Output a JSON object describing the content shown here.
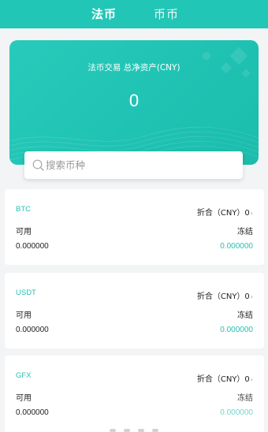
{
  "tabs": [
    {
      "label": "法币",
      "active": true
    },
    {
      "label": "币币",
      "active": false
    }
  ],
  "colors": {
    "accent": "#22c6b6",
    "coin_name": "#27bfb2",
    "background": "#f2f4f5"
  },
  "asset_card": {
    "title": "法币交易 总净资产(CNY)",
    "value": "0"
  },
  "search": {
    "placeholder": "搜索币种",
    "value": "",
    "icon": "search-icon"
  },
  "coins": [
    {
      "name": "BTC",
      "conversion": "折合（CNY）0",
      "available_label": "可用",
      "frozen_label": "冻结",
      "available_value": "0.000000",
      "frozen_value": "0.000000"
    },
    {
      "name": "USDT",
      "conversion": "折合（CNY）0",
      "available_label": "可用",
      "frozen_label": "冻结",
      "available_value": "0.000000",
      "frozen_value": "0.000000"
    },
    {
      "name": "GFX",
      "conversion": "折合（CNY）0",
      "available_label": "可用",
      "frozen_label": "冻结",
      "available_value": "0.000000",
      "frozen_value": "0.000000"
    }
  ],
  "chevron_icon": "chevron-right-icon"
}
